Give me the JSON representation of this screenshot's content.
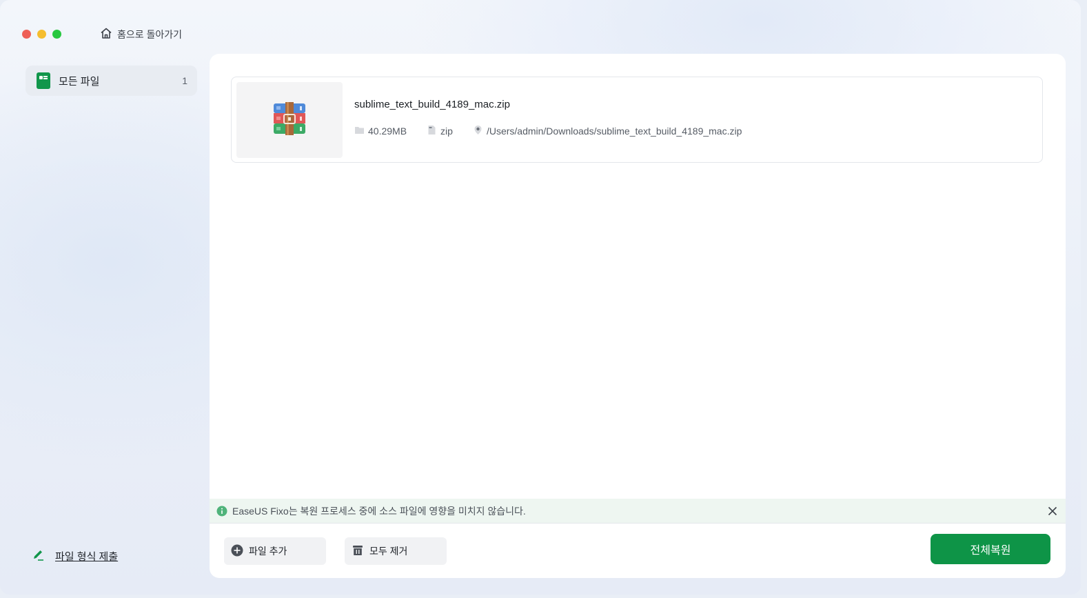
{
  "window": {
    "nav": {
      "home_label": "홈으로 돌아가기"
    }
  },
  "sidebar": {
    "items": [
      {
        "label": "모든 파일",
        "count": "1",
        "icon": "file-icon"
      }
    ],
    "footer_link": "파일 형식 제출"
  },
  "files": [
    {
      "name": "sublime_text_build_4189_mac.zip",
      "size": "40.29MB",
      "type": "zip",
      "path": "/Users/admin/Downloads/sublime_text_build_4189_mac.zip",
      "thumbnail_icon": "archive-icon"
    }
  ],
  "info_bar": {
    "text": "EaseUS Fixo는 복원 프로세스 중에 소스 파일에 영향을 미치지 않습니다."
  },
  "actions": {
    "add_files": "파일 추가",
    "remove_all": "모두 제거",
    "repair_all": "전체복원"
  },
  "colors": {
    "accent": "#0e9447",
    "close": "#ee5f57",
    "minimize": "#f5bd2f",
    "maximize": "#28c840"
  }
}
